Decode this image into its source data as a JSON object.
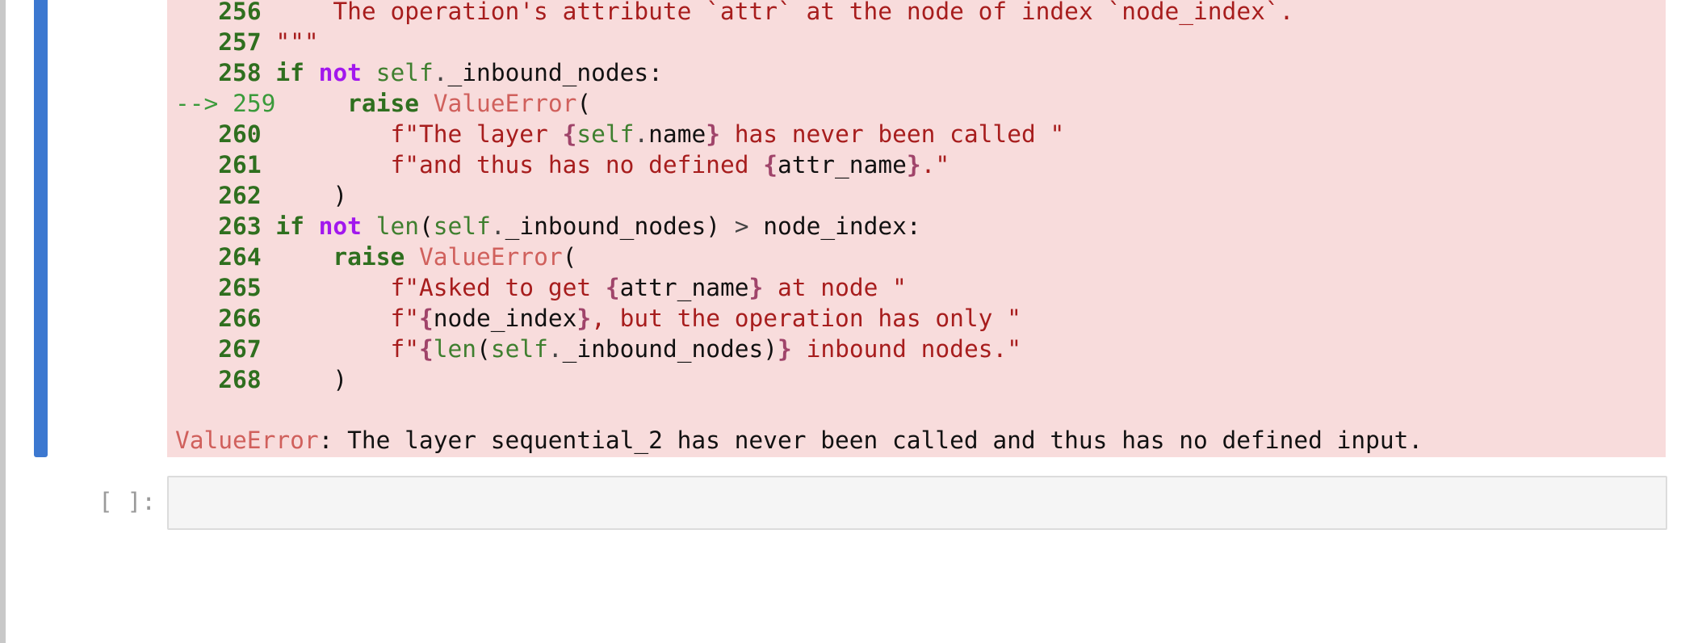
{
  "traceback": {
    "lines": [
      {
        "num": "256",
        "code": "    The operation's attribute `attr` at the node of index `node_index`."
      },
      {
        "num": "257",
        "code": "\"\"\""
      },
      {
        "num": "258",
        "code": "if not self._inbound_nodes:"
      },
      {
        "arrow": "-->",
        "num": "259",
        "code": "    raise ValueError("
      },
      {
        "num": "260",
        "code": "        f\"The layer {self.name} has never been called \""
      },
      {
        "num": "261",
        "code": "        f\"and thus has no defined {attr_name}.\""
      },
      {
        "num": "262",
        "code": "    )"
      },
      {
        "num": "263",
        "code": "if not len(self._inbound_nodes) > node_index:"
      },
      {
        "num": "264",
        "code": "    raise ValueError("
      },
      {
        "num": "265",
        "code": "        f\"Asked to get {attr_name} at node \""
      },
      {
        "num": "266",
        "code": "        f\"{node_index}, but the operation has only \""
      },
      {
        "num": "267",
        "code": "        f\"{len(self._inbound_nodes)} inbound nodes.\""
      },
      {
        "num": "268",
        "code": "    )"
      }
    ],
    "error_type": "ValueError",
    "error_message": ": The layer sequential_2 has never been called and thus has no defined input."
  },
  "next_cell": {
    "prompt": "[ ]:",
    "value": ""
  },
  "colors": {
    "cell_marker": "#3c78d0",
    "error_background": "#f8dcdc",
    "line_number": "#2f6f1f",
    "keyword_not": "#a217ee",
    "exception_name": "#d0605c",
    "string": "#a71d1d"
  }
}
